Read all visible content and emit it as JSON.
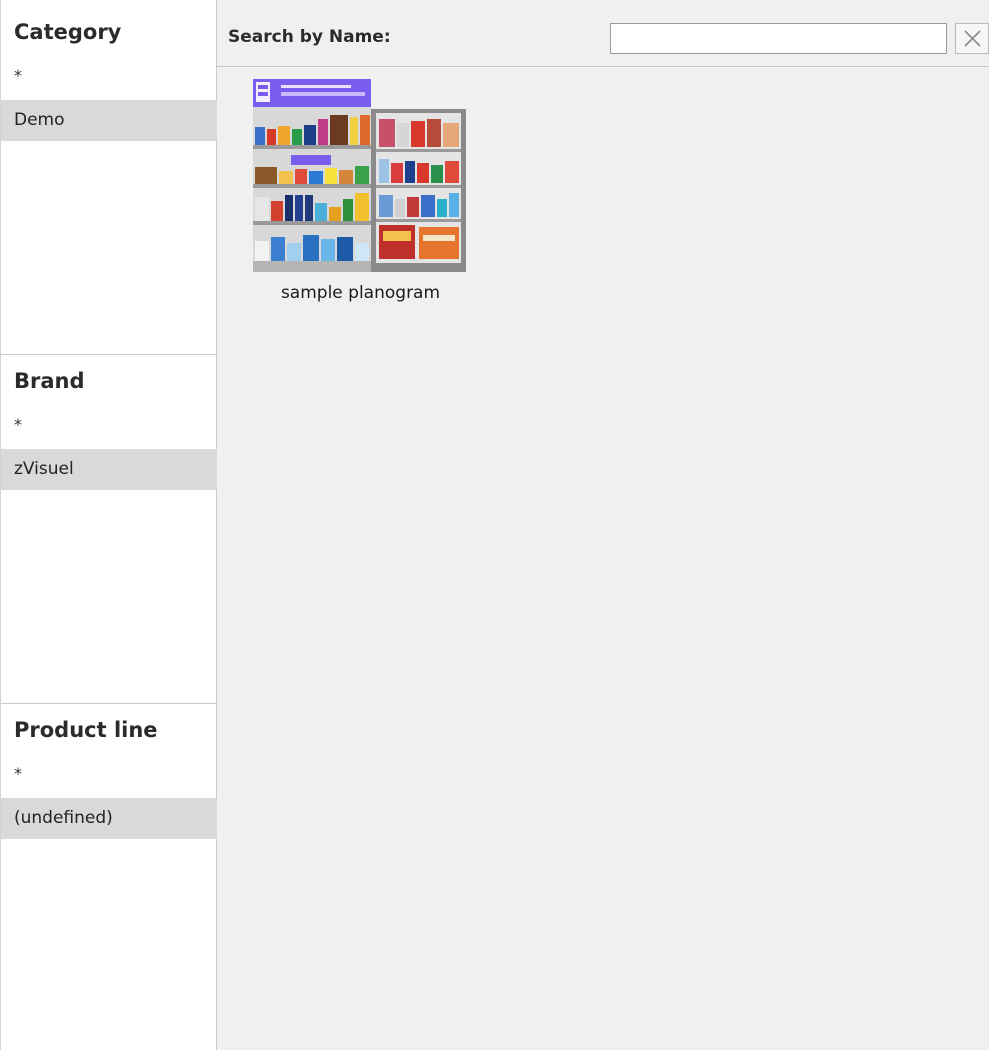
{
  "filters": {
    "category": {
      "title": "Category",
      "all": "*",
      "selected": "Demo"
    },
    "brand": {
      "title": "Brand",
      "all": "*",
      "selected": "zVisuel"
    },
    "product_line": {
      "title": "Product line",
      "all": "*",
      "selected": "(undefined)"
    }
  },
  "search": {
    "label": "Search by Name:",
    "value": "",
    "clear_icon": "close-icon"
  },
  "items": [
    {
      "label": "sample planogram",
      "thumbnail_icon": "planogram-thumbnail"
    }
  ],
  "colors": {
    "selected_row": "#d9d9d9",
    "panel_bg": "#f0f0f0",
    "brand_header": "#7b5cf0"
  }
}
